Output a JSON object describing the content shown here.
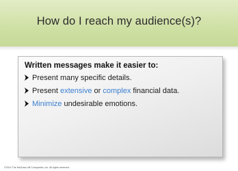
{
  "slide": {
    "title": "How do I reach my audience(s)?",
    "heading": "Written messages make it easier to:",
    "bullets": [
      {
        "before": "Present many specific details.",
        "highlight": "",
        "middle": "",
        "highlight2": "",
        "after": ""
      },
      {
        "before": "Present ",
        "highlight": "extensive",
        "middle": " or ",
        "highlight2": "complex",
        "after": " financial data."
      },
      {
        "before": "",
        "highlight": "Minimize",
        "middle": " undesirable emotions.",
        "highlight2": "",
        "after": ""
      }
    ],
    "footer": "©2014 The McGraw-Hill Companies, Inc. All rights reserved."
  },
  "colors": {
    "title_band": "#cfe0a4",
    "highlight": "#3b7fd1",
    "bullet_arrow": "#111111"
  },
  "icons": {
    "bullet": "right-arrowhead-icon"
  }
}
